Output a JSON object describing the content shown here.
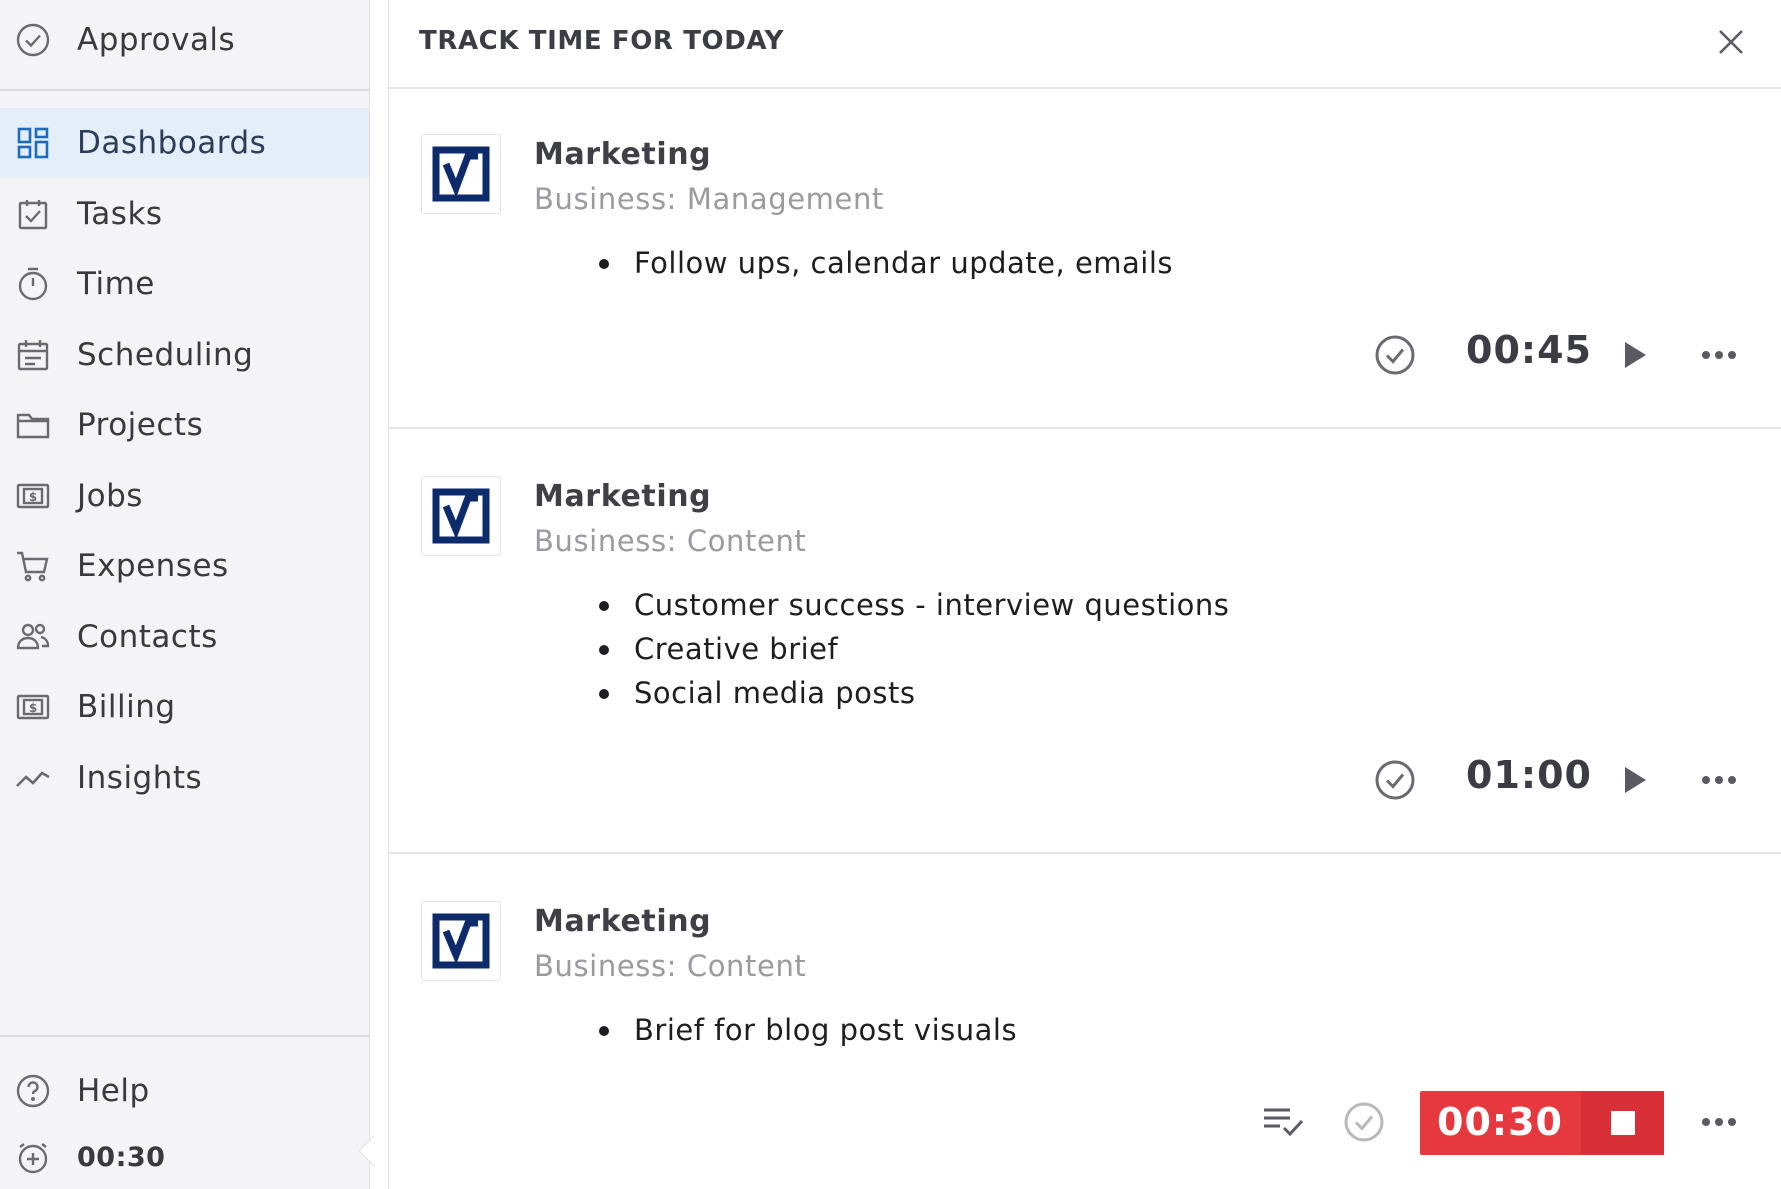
{
  "sidebar": {
    "top_item": {
      "label": "Approvals",
      "icon": "check-circle-icon"
    },
    "items": [
      {
        "label": "Dashboards",
        "icon": "dashboard-icon",
        "active": true
      },
      {
        "label": "Tasks",
        "icon": "task-icon"
      },
      {
        "label": "Time",
        "icon": "stopwatch-icon"
      },
      {
        "label": "Scheduling",
        "icon": "calendar-icon"
      },
      {
        "label": "Projects",
        "icon": "folder-icon"
      },
      {
        "label": "Jobs",
        "icon": "dollar-bill-icon"
      },
      {
        "label": "Expenses",
        "icon": "cart-icon"
      },
      {
        "label": "Contacts",
        "icon": "people-icon"
      },
      {
        "label": "Billing",
        "icon": "dollar-bill-icon"
      },
      {
        "label": "Insights",
        "icon": "trend-line-icon"
      }
    ],
    "help_label": "Help",
    "timer_label": "00:30"
  },
  "panel": {
    "title": "TRACK TIME FOR TODAY",
    "entries": [
      {
        "title": "Marketing",
        "subtitle": "Business: Management",
        "notes": [
          "Follow ups, calendar update, emails"
        ],
        "time": "00:45",
        "running": false
      },
      {
        "title": "Marketing",
        "subtitle": "Business: Content",
        "notes": [
          "Customer success - interview questions",
          "Creative brief",
          "Social media posts"
        ],
        "time": "01:00",
        "running": false
      },
      {
        "title": "Marketing",
        "subtitle": "Business: Content",
        "notes": [
          "Brief for blog post visuals"
        ],
        "time": "00:30",
        "running": true
      }
    ]
  },
  "colors": {
    "accent": "#1f6bb8",
    "logo_navy": "#0d2b6b",
    "running_red": "#e8383f",
    "active_bg": "#e4eef9"
  }
}
